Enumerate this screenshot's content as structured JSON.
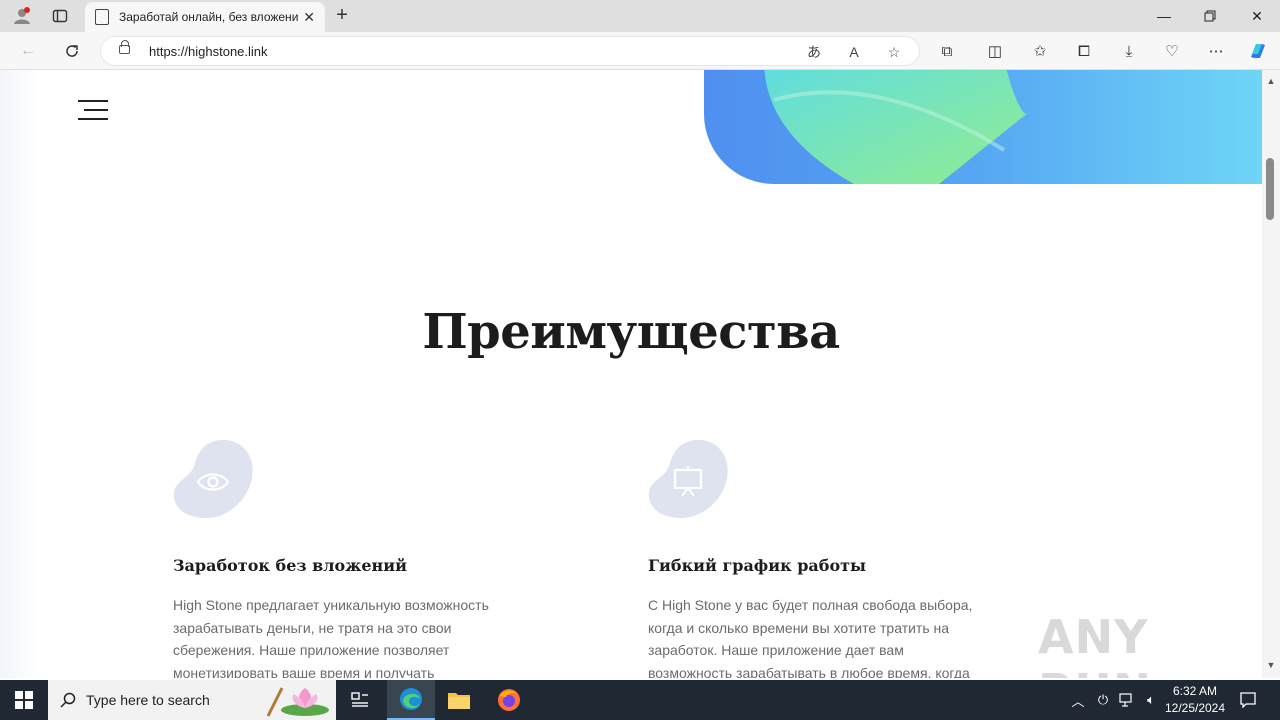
{
  "browser": {
    "tab_title": "Заработай онлайн, без вложени",
    "url": "https://highstone.link",
    "icons": {
      "profile": "profile-icon",
      "tab_actions": "tab-actions-icon",
      "translate": "translate-icon",
      "read_aloud": "read-aloud-icon",
      "favorite": "star-icon",
      "extensions": "puzzle-icon",
      "split": "split-screen-icon",
      "favorites": "favorites-icon",
      "collections": "collections-icon",
      "downloads": "download-icon",
      "performance": "performance-icon",
      "more": "more-icon",
      "copilot": "copilot-icon"
    }
  },
  "page": {
    "section_title": "Преимущества",
    "features": [
      {
        "icon": "eye-icon",
        "title": "Заработок без вложений",
        "text": "High Stone предлагает уникальную возможность зарабатывать деньги, не тратя на это свои сбережения. Наше приложение позволяет монетизировать ваше время и получать"
      },
      {
        "icon": "presentation-icon",
        "title": "Гибкий график работы",
        "text": "С High Stone у вас будет полная свобода выбора, когда и сколько времени вы хотите тратить на заработок. Наше приложение дает вам возможность зарабатывать в любое время, когда"
      }
    ]
  },
  "watermark": "ANY RUN",
  "taskbar": {
    "search_placeholder": "Type here to search",
    "time": "6:32 AM",
    "date": "12/25/2024"
  },
  "colors": {
    "accent_blue": "#4aa3f0",
    "accent_green": "#7ee8a0",
    "icon_blob": "#dfe3f0"
  }
}
